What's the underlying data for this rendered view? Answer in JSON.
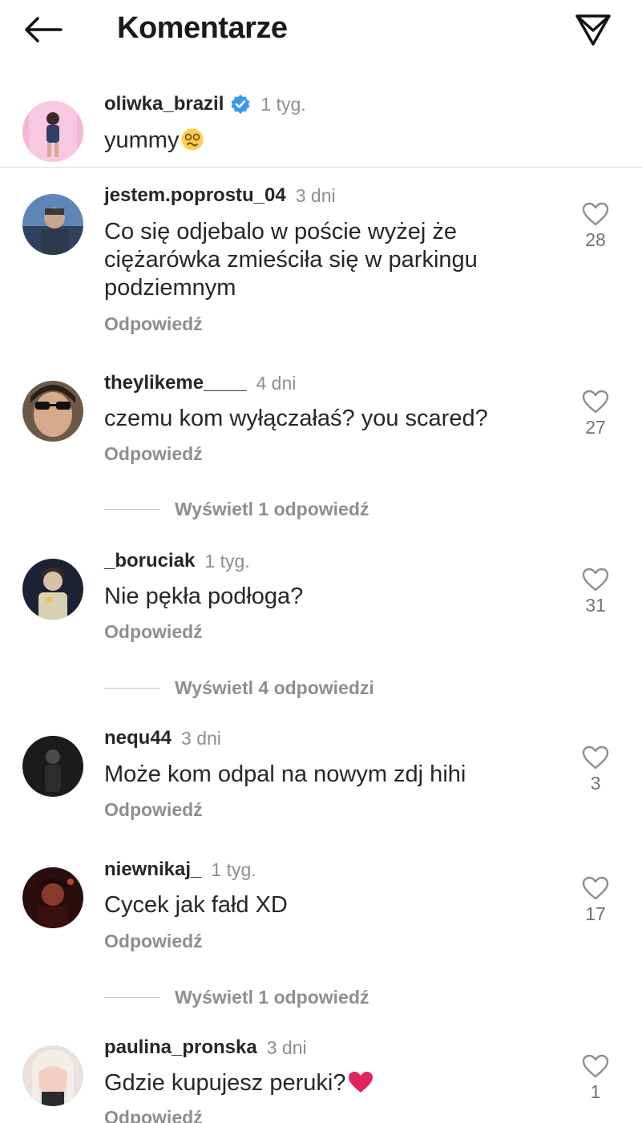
{
  "header": {
    "title": "Komentarze",
    "back_icon": "arrow-left-icon",
    "share_icon": "paper-plane-icon"
  },
  "caption": {
    "username": "oliwka_brazil",
    "verified": true,
    "time": "1 tyg.",
    "text": "yummy",
    "emoji": "woozy-face-emoji"
  },
  "reply_label": "Odpowiedź",
  "comments": [
    {
      "username": "jestem.poprostu_04",
      "time": "3 dni",
      "text": "Co się odjebalo w poście wyżej że ciężarówka zmieściła się w parkingu podziemnym",
      "likes": "28",
      "reply": "Odpowiedź"
    },
    {
      "username": "theylikeme____",
      "time": "4 dni",
      "text": "czemu kom wyłączałaś? you scared?",
      "likes": "27",
      "reply": "Odpowiedź",
      "view_replies": "Wyświetl 1 odpowiedź"
    },
    {
      "username": "_boruciak",
      "time": "1 tyg.",
      "text": "Nie pękła podłoga?",
      "likes": "31",
      "reply": "Odpowiedź",
      "view_replies": "Wyświetl 4 odpowiedzi"
    },
    {
      "username": "nequ44",
      "time": "3 dni",
      "text": "Może kom odpal na nowym zdj hihi",
      "likes": "3",
      "reply": "Odpowiedź"
    },
    {
      "username": "niewnikaj_",
      "time": "1 tyg.",
      "text": "Cycek jak fałd XD",
      "likes": "17",
      "reply": "Odpowiedź",
      "view_replies": "Wyświetl 1 odpowiedź"
    },
    {
      "username": "paulina_pronska",
      "time": "3 dni",
      "text": "Gdzie kupujesz peruki?",
      "emoji": "red-heart-emoji",
      "likes": "1",
      "reply": "Odpowiedź"
    }
  ],
  "colors": {
    "text": "#262626",
    "secondary": "#8e8e8e",
    "verified": "#3897f0",
    "heart_emoji": "#e0245e"
  }
}
